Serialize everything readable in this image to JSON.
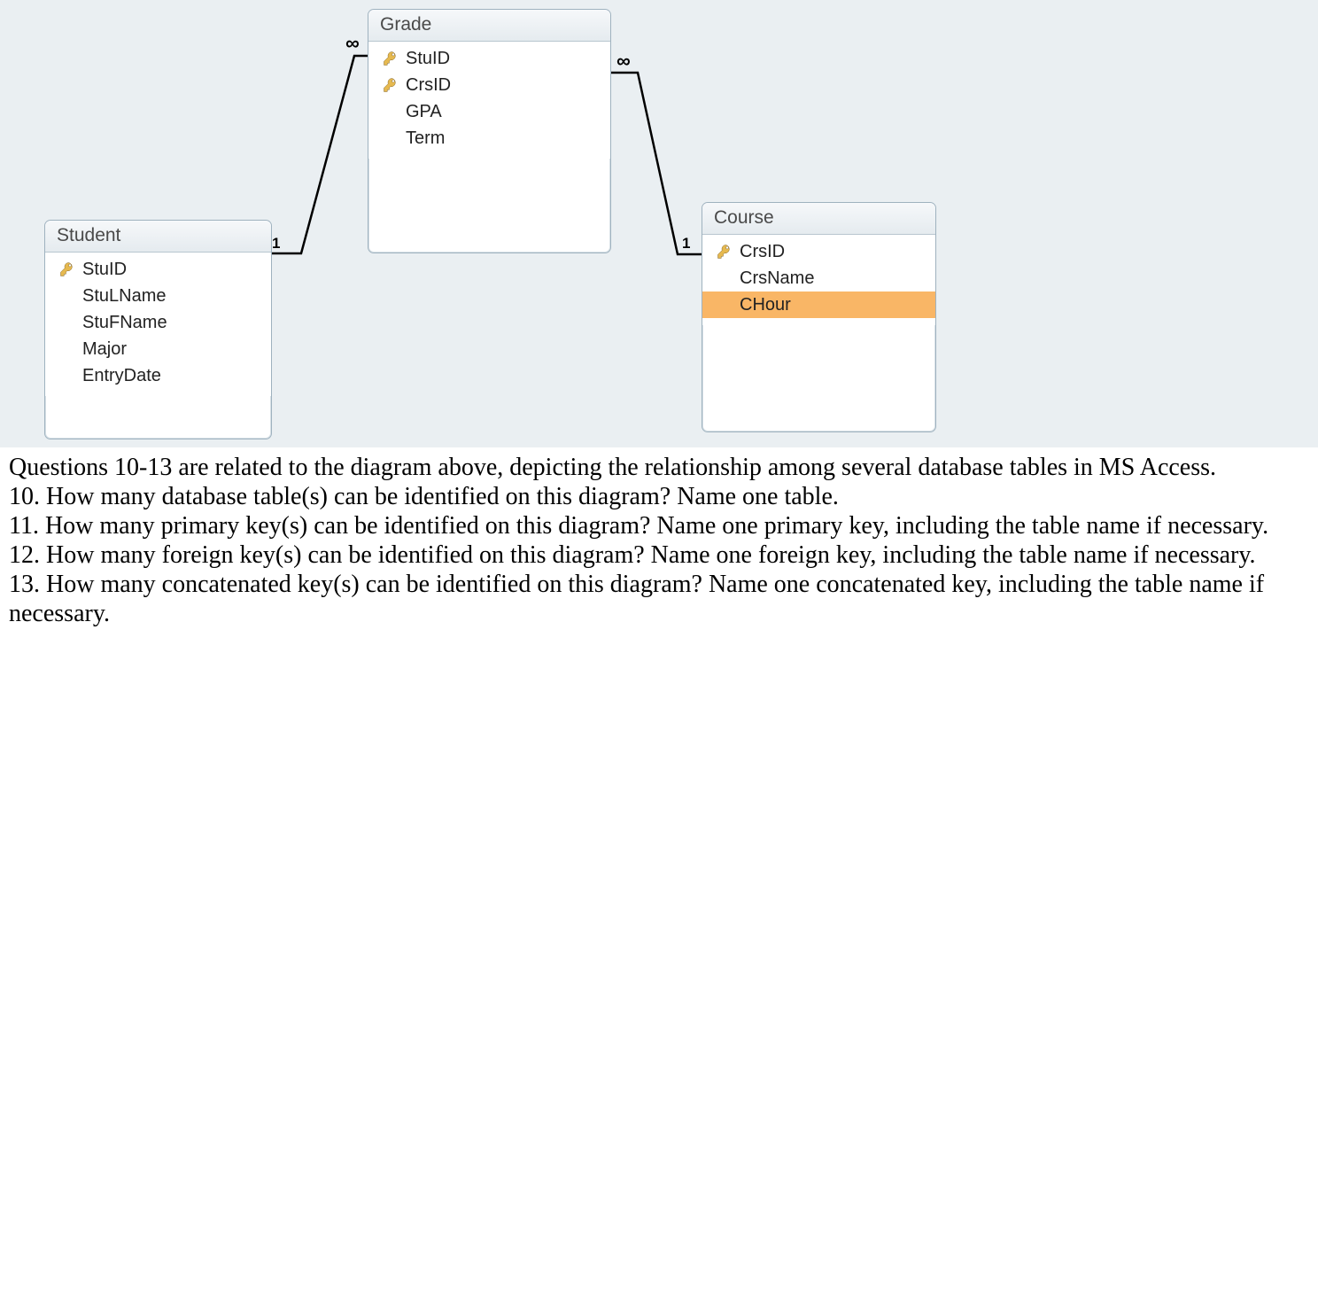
{
  "diagram": {
    "tables": {
      "student": {
        "title": "Student",
        "fields": [
          {
            "label": "StuID",
            "key": true
          },
          {
            "label": "StuLName",
            "key": false
          },
          {
            "label": "StuFName",
            "key": false
          },
          {
            "label": "Major",
            "key": false
          },
          {
            "label": "EntryDate",
            "key": false
          }
        ]
      },
      "grade": {
        "title": "Grade",
        "fields": [
          {
            "label": "StuID",
            "key": true
          },
          {
            "label": "CrsID",
            "key": true
          },
          {
            "label": "GPA",
            "key": false
          },
          {
            "label": "Term",
            "key": false
          }
        ]
      },
      "course": {
        "title": "Course",
        "fields": [
          {
            "label": "CrsID",
            "key": true
          },
          {
            "label": "CrsName",
            "key": false
          },
          {
            "label": "CHour",
            "key": false,
            "selected": true
          }
        ]
      }
    },
    "relations": {
      "student_grade": {
        "left": "1",
        "right": "∞"
      },
      "course_grade": {
        "left": "∞",
        "right": "1"
      }
    }
  },
  "text": {
    "intro": "Questions 10-13 are related to the diagram above, depicting the relationship among several database tables in MS Access.",
    "q10": "10. How many database table(s) can be identified on this diagram? Name one table.",
    "q11": "11. How many primary key(s) can be identified on this diagram? Name one primary key, including the table name if necessary.",
    "q12": "12. How many foreign key(s) can be identified on this diagram? Name one foreign key, including the table name if necessary.",
    "q13": "13. How many concatenated key(s) can be identified on this diagram? Name one concatenated key, including the table name if necessary."
  }
}
